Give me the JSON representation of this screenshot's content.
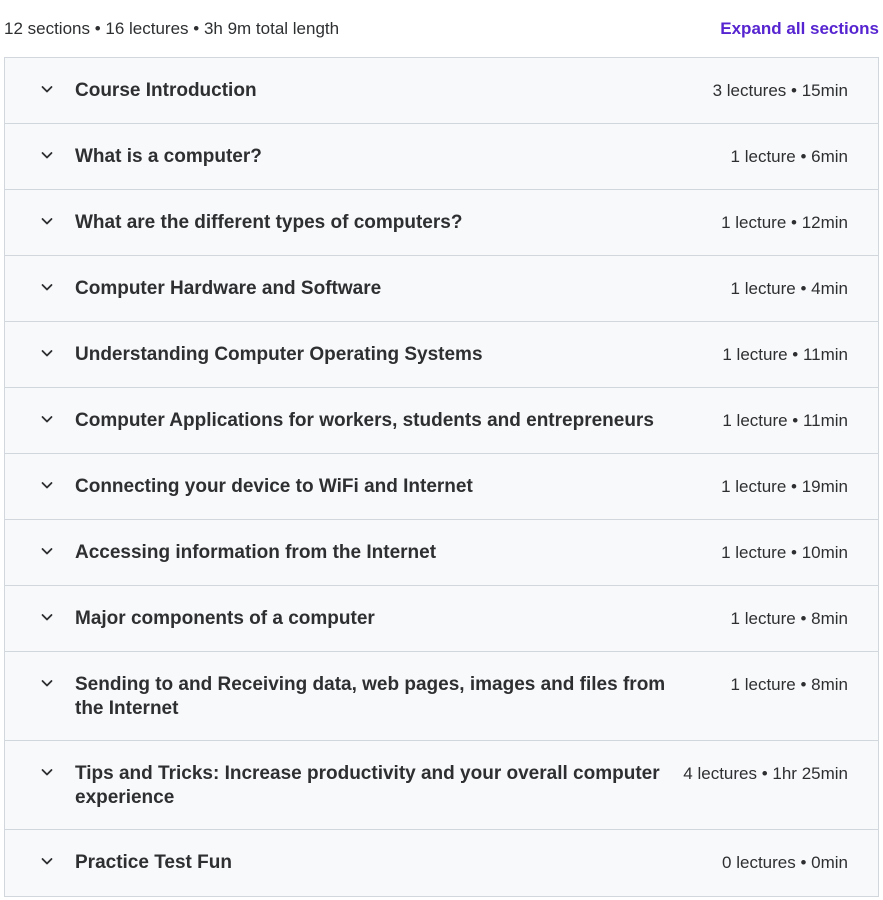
{
  "summary": {
    "text": "12 sections • 16 lectures • 3h 9m total length",
    "expand_label": "Expand all sections"
  },
  "colors": {
    "accent": "#5624d0",
    "row_bg": "#f7f9fa",
    "border": "#d1d7dc",
    "text": "#2d2f31"
  },
  "icons": {
    "section_toggle": "chevron-down-icon"
  },
  "sections": [
    {
      "title": "Course Introduction",
      "meta": "3 lectures • 15min"
    },
    {
      "title": "What is a computer?",
      "meta": "1 lecture • 6min"
    },
    {
      "title": "What are the different types of computers?",
      "meta": "1 lecture • 12min"
    },
    {
      "title": "Computer Hardware and Software",
      "meta": "1 lecture • 4min"
    },
    {
      "title": "Understanding Computer Operating Systems",
      "meta": "1 lecture • 11min"
    },
    {
      "title": "Computer Applications for workers, students and entrepreneurs",
      "meta": "1 lecture • 11min"
    },
    {
      "title": "Connecting your device to WiFi and Internet",
      "meta": "1 lecture • 19min"
    },
    {
      "title": "Accessing information from the Internet",
      "meta": "1 lecture • 10min"
    },
    {
      "title": "Major components of a computer",
      "meta": "1 lecture • 8min"
    },
    {
      "title": "Sending to and Receiving data, web pages, images and files from the Internet",
      "meta": "1 lecture • 8min"
    },
    {
      "title": "Tips and Tricks: Increase productivity and your overall computer experience",
      "meta": "4 lectures • 1hr 25min"
    },
    {
      "title": "Practice Test Fun",
      "meta": "0 lectures • 0min"
    }
  ]
}
